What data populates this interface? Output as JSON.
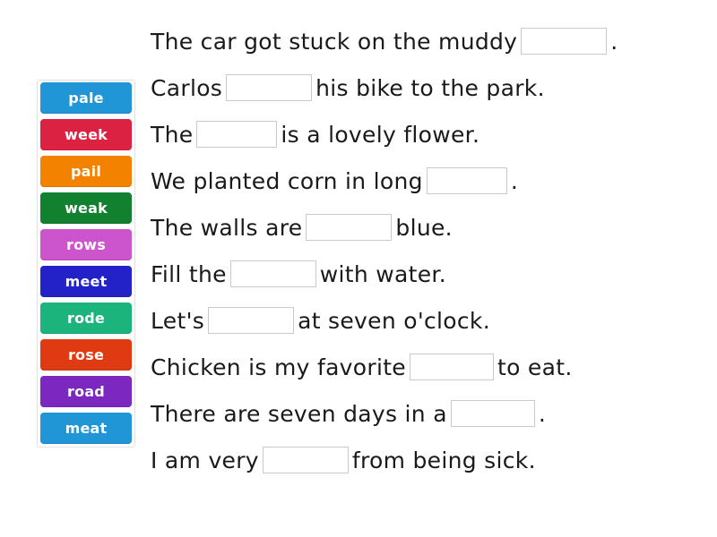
{
  "activity": {
    "type": "drag-and-drop-fill-in-the-blank"
  },
  "word_bank": {
    "name": "word-bank",
    "tiles": [
      {
        "label": "pale",
        "color": "#2196d6"
      },
      {
        "label": "week",
        "color": "#db2242"
      },
      {
        "label": "pail",
        "color": "#f28200"
      },
      {
        "label": "weak",
        "color": "#11802f"
      },
      {
        "label": "rows",
        "color": "#cc55ce"
      },
      {
        "label": "meet",
        "color": "#2222c8"
      },
      {
        "label": "rode",
        "color": "#1bb47c"
      },
      {
        "label": "rose",
        "color": "#e03a12"
      },
      {
        "label": "road",
        "color": "#7b27c0"
      },
      {
        "label": "meat",
        "color": "#2196d6"
      }
    ]
  },
  "sentences": [
    {
      "id": "sentence-1",
      "before": "The car got stuck on the muddy",
      "blank_value": "",
      "blank_width": 96,
      "after": "."
    },
    {
      "id": "sentence-2",
      "before": "Carlos",
      "blank_value": "",
      "blank_width": 96,
      "after": "his bike to the park."
    },
    {
      "id": "sentence-3",
      "before": "The",
      "blank_value": "",
      "blank_width": 90,
      "after": "is a lovely flower."
    },
    {
      "id": "sentence-4",
      "before": "We planted corn in long",
      "blank_value": "",
      "blank_width": 90,
      "after": "."
    },
    {
      "id": "sentence-5",
      "before": "The walls are",
      "blank_value": "",
      "blank_width": 96,
      "after": "blue."
    },
    {
      "id": "sentence-6",
      "before": "Fill the",
      "blank_value": "",
      "blank_width": 96,
      "after": "with water."
    },
    {
      "id": "sentence-7",
      "before": "Let's",
      "blank_value": "",
      "blank_width": 96,
      "after": "at seven o'clock."
    },
    {
      "id": "sentence-8",
      "before": "Chicken is my favorite",
      "blank_value": "",
      "blank_width": 94,
      "after": "to eat."
    },
    {
      "id": "sentence-9",
      "before": "There are seven days in a",
      "blank_value": "",
      "blank_width": 94,
      "after": "."
    },
    {
      "id": "sentence-10",
      "before": "I am very",
      "blank_value": "",
      "blank_width": 96,
      "after": "from being sick."
    }
  ]
}
